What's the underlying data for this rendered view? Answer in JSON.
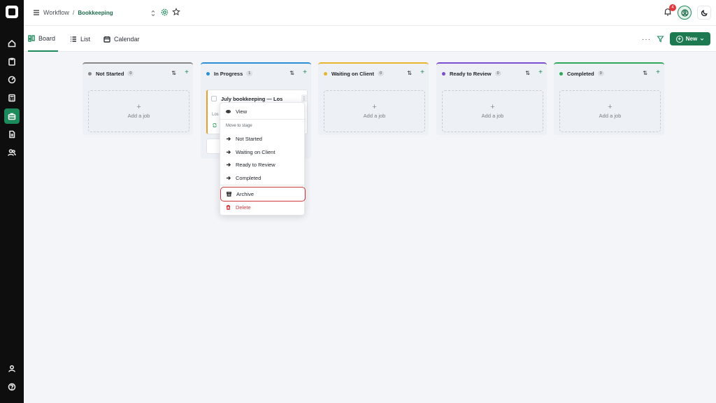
{
  "header": {
    "breadcrumb_root": "Workflow",
    "breadcrumb_separator": "/",
    "breadcrumb_current": "Bookkeeping",
    "notification_count": "4"
  },
  "views": {
    "tabs": [
      {
        "label": "Board"
      },
      {
        "label": "List"
      },
      {
        "label": "Calendar"
      }
    ],
    "more_label": "···",
    "new_label": "New"
  },
  "board": {
    "columns": [
      {
        "title": "Not Started",
        "count": "0",
        "color": "#888888",
        "add_label": "Add a job"
      },
      {
        "title": "In Progress",
        "count": "1",
        "color": "#2b8fd6",
        "add_label": ""
      },
      {
        "title": "Waiting on Client",
        "count": "0",
        "color": "#e8b52d",
        "add_label": "Add a job"
      },
      {
        "title": "Ready to Review",
        "count": "0",
        "color": "#7a4fd1",
        "add_label": "Add a job"
      },
      {
        "title": "Completed",
        "count": "0",
        "color": "#2fa85a",
        "add_label": "Add a job"
      }
    ],
    "job": {
      "title": "July bookkeeping — Los",
      "subtitle": "Los"
    }
  },
  "context_menu": {
    "view": "View",
    "section_label": "Move to stage",
    "stages": [
      "Not Started",
      "Waiting on Client",
      "Ready to Review",
      "Completed"
    ],
    "archive": "Archive",
    "delete": "Delete"
  },
  "colors": {
    "accent": "#1d8a5b",
    "danger": "#d6383c",
    "rail": "#0e0e0e"
  }
}
